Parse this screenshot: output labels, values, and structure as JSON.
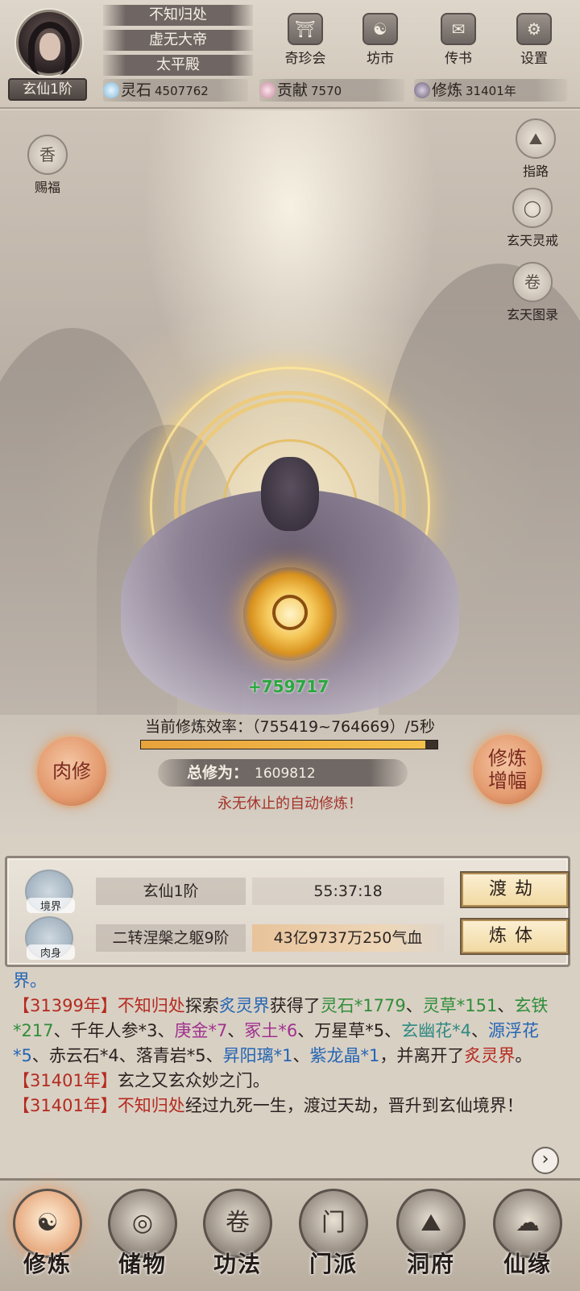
{
  "player": {
    "name": "不知归处",
    "title": "虚无大帝",
    "hall": "太平殿",
    "rank": "玄仙1阶"
  },
  "top_menu": [
    {
      "label": "奇珍会",
      "icon": "treasure-pavilion-icon",
      "glyph": "⛩"
    },
    {
      "label": "坊市",
      "icon": "market-icon",
      "glyph": "☯"
    },
    {
      "label": "传书",
      "icon": "letter-scroll-icon",
      "glyph": "✉"
    },
    {
      "label": "设置",
      "icon": "gear-icon",
      "glyph": "⚙"
    }
  ],
  "resources": {
    "spirit_stone": {
      "label": "灵石",
      "value": "4507762"
    },
    "contribution": {
      "label": "贡献",
      "value": "7570"
    },
    "cultivation_years": {
      "label": "修炼",
      "value": "31401年"
    }
  },
  "side": {
    "blessing": "赐福",
    "guide": "指路",
    "ring": "玄天灵戒",
    "atlas": "玄天图录"
  },
  "cultivation": {
    "gain": "+759717",
    "efficiency_label": "当前修炼效率：（755419~764669）/5秒",
    "efficiency_progress": 0.96,
    "total_label": "总修为：",
    "total_value": "1609812",
    "auto_text": "永无休止的自动修炼！",
    "body_button": "肉修",
    "boost_button_line1": "修炼",
    "boost_button_line2": "增幅"
  },
  "status": {
    "realm": {
      "icon_label": "境界",
      "name": "玄仙1阶",
      "value": "55:37:18",
      "action": "渡劫"
    },
    "body": {
      "icon_label": "肉身",
      "name": "二转涅槃之躯9阶",
      "value": "43亿9737万250气血",
      "action": "炼体"
    }
  },
  "log": {
    "l0": "界。",
    "e1_year": "【31399年】",
    "e1_name": "不知归处",
    "e1_t1": "探索",
    "e1_place": "炙灵界",
    "e1_t2": "获得了",
    "e1_i1": "灵石*1779",
    "e1_sep1": "、",
    "e1_i2": "灵草*151",
    "e1_sep2": "、",
    "e1_i3": "玄铁*217",
    "e1_t3": "、千年人参*3、",
    "e1_i4": "庚金*7",
    "e1_sep3": "、",
    "e1_i5": "冢土*6",
    "e1_t4": "、万星草*5、",
    "e1_i6": "玄幽花*4",
    "e1_sep4": "、",
    "e1_i7": "源浮花*5",
    "e1_t5": "、赤云石*4、落青岩*5、",
    "e1_i8": "昇阳璃*1",
    "e1_sep5": "、",
    "e1_i9": "紫龙晶*1",
    "e1_t6": "，并离开了",
    "e1_place2": "炙灵界",
    "e1_t7": "。",
    "e2_year": "【31401年】",
    "e2_text": "玄之又玄众妙之门。",
    "e3_year": "【31401年】",
    "e3_name": "不知归处",
    "e3_text": "经过九死一生，渡过天劫，晋升到玄仙境界！"
  },
  "bottom_nav": [
    {
      "label": "修炼",
      "icon": "meditating-sage-icon",
      "glyph": "☯",
      "active": true
    },
    {
      "label": "储物",
      "icon": "storage-bag-icon",
      "glyph": "◎",
      "active": false
    },
    {
      "label": "功法",
      "icon": "technique-scroll-icon",
      "glyph": "卷",
      "active": false
    },
    {
      "label": "门派",
      "icon": "sect-gate-icon",
      "glyph": "门",
      "active": false
    },
    {
      "label": "洞府",
      "icon": "cave-abode-icon",
      "glyph": "⛰",
      "active": false
    },
    {
      "label": "仙缘",
      "icon": "immortal-fate-icon",
      "glyph": "☁",
      "active": false
    }
  ],
  "colors": {
    "accent_red": "#b52a1f",
    "item_green": "#2f8e39",
    "item_blue": "#2466b4",
    "item_purple": "#a1328f",
    "gain_green": "#29a83d"
  }
}
